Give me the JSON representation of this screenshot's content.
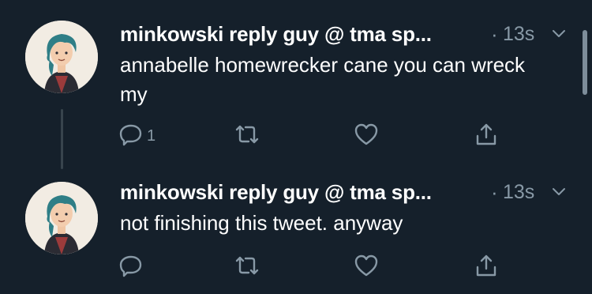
{
  "tweets": [
    {
      "display_name": "minkowski reply guy @ tma sp...",
      "separator": "·",
      "timestamp": "13s",
      "text": "annabelle homewrecker cane you can wreck my",
      "reply_count": "1"
    },
    {
      "display_name": "minkowski reply guy @ tma sp...",
      "separator": "·",
      "timestamp": "13s",
      "text": "not finishing this tweet. anyway",
      "reply_count": ""
    }
  ],
  "colors": {
    "background": "#15202b",
    "primary_text": "#ffffff",
    "secondary_text": "#8899a6",
    "thread_line": "#38444d",
    "avatar_background": "#f2ece3",
    "avatar_hair": "#2f7e86"
  },
  "icons": {
    "reply": "reply-icon",
    "retweet": "retweet-icon",
    "like": "heart-icon",
    "share": "share-icon",
    "more": "chevron-down-icon"
  }
}
